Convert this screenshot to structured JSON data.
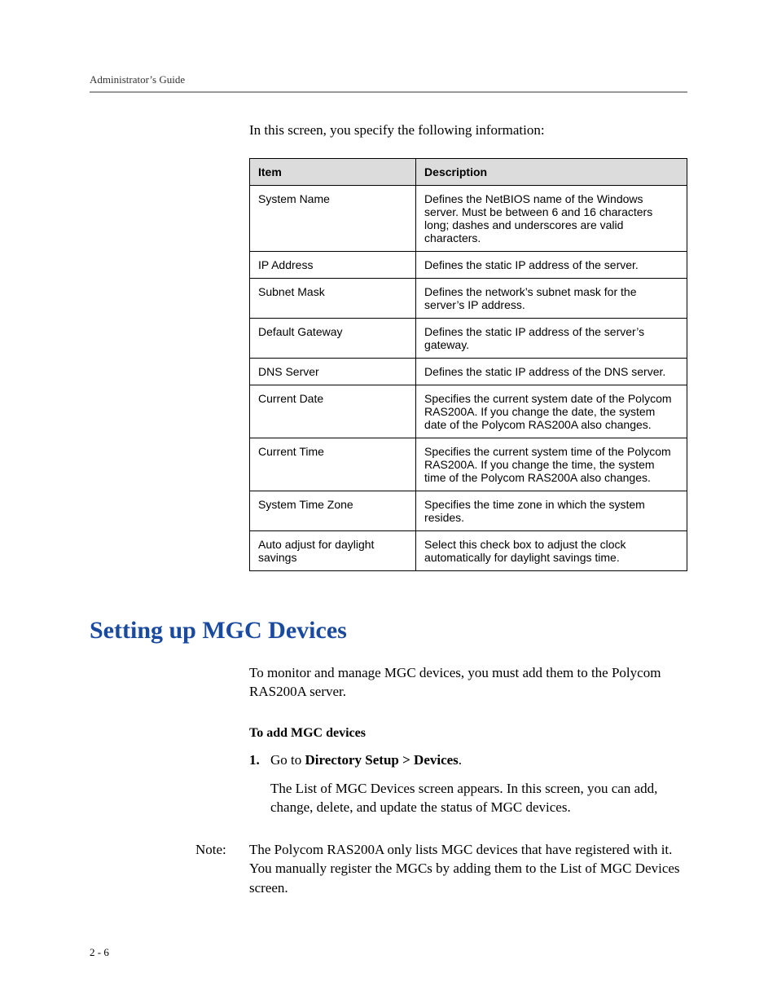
{
  "header": {
    "running": "Administrator’s Guide"
  },
  "intro": "In this screen, you specify the following information:",
  "table": {
    "head_item": "Item",
    "head_desc": "Description",
    "rows": [
      {
        "item": "System Name",
        "desc": "Defines the NetBIOS name of the Windows server. Must be between 6 and 16 characters long; dashes and underscores are valid characters."
      },
      {
        "item": "IP Address",
        "desc": "Defines the static IP address of the server."
      },
      {
        "item": "Subnet Mask",
        "desc": "Defines the network’s subnet mask for the server’s IP address."
      },
      {
        "item": "Default Gateway",
        "desc": "Defines the static IP address of the server’s gateway."
      },
      {
        "item": "DNS Server",
        "desc": "Defines the static IP address of the DNS server."
      },
      {
        "item": "Current Date",
        "desc": "Specifies the current system date of the Polycom RAS200A. If you change the date, the system date of the Polycom RAS200A also changes."
      },
      {
        "item": "Current Time",
        "desc": "Specifies the current system time of the Polycom RAS200A. If you change the time, the system time of the Polycom RAS200A also changes."
      },
      {
        "item": "System Time Zone",
        "desc": "Specifies the time zone in which the system resides."
      },
      {
        "item": "Auto adjust for daylight savings",
        "desc": "Select this check box to adjust the clock automatically for daylight savings time."
      }
    ]
  },
  "section": {
    "heading": "Setting up MGC Devices",
    "para": "To monitor and manage MGC devices, you must add them to the Polycom RAS200A server.",
    "subhead": "To add MGC devices",
    "step_num": "1.",
    "step_prefix": "Go to ",
    "step_bold": "Directory Setup > Devices",
    "step_suffix": ".",
    "step_result": "The List of MGC Devices screen appears. In this screen, you can add, change, delete, and update the status of MGC devices.",
    "note_label": "Note:",
    "note_text": "The Polycom RAS200A only lists MGC devices that have registered with it. You manually register the MGCs by adding them to the List of MGC Devices screen."
  },
  "footer": {
    "pagenum": "2 - 6"
  }
}
